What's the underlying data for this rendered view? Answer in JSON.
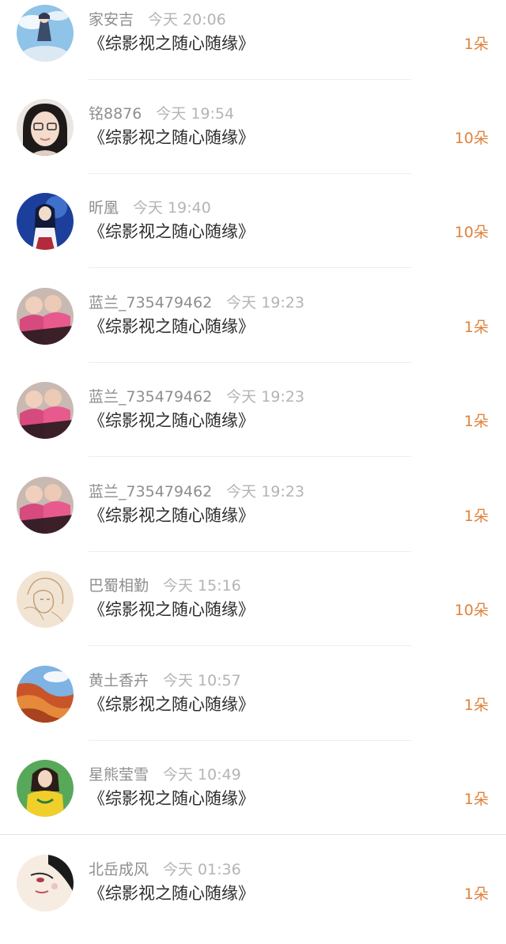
{
  "items": [
    {
      "user": "家安吉",
      "time": "今天 20:06",
      "title": "《综影视之随心随缘》",
      "count": "1朵",
      "avatar": "anime-sky-avatar"
    },
    {
      "user": "铭8876",
      "time": "今天 19:54",
      "title": "《综影视之随心随缘》",
      "count": "10朵",
      "avatar": "girl-glasses-avatar"
    },
    {
      "user": "昕凰",
      "time": "今天 19:40",
      "title": "《综影视之随心随缘》",
      "count": "10朵",
      "avatar": "anime-girl-blue-avatar"
    },
    {
      "user": "蓝兰_735479462",
      "time": "今天 19:23",
      "title": "《综影视之随心随缘》",
      "count": "1朵",
      "avatar": "children-pink-avatar"
    },
    {
      "user": "蓝兰_735479462",
      "time": "今天 19:23",
      "title": "《综影视之随心随缘》",
      "count": "1朵",
      "avatar": "children-pink-avatar"
    },
    {
      "user": "蓝兰_735479462",
      "time": "今天 19:23",
      "title": "《综影视之随心随缘》",
      "count": "1朵",
      "avatar": "children-pink-avatar"
    },
    {
      "user": "巴蜀相勤",
      "time": "今天 15:16",
      "title": "《综影视之随心随缘》",
      "count": "10朵",
      "avatar": "sketch-portrait-avatar"
    },
    {
      "user": "黄土香卉",
      "time": "今天 10:57",
      "title": "《综影视之随心随缘》",
      "count": "1朵",
      "avatar": "canyon-landscape-avatar"
    },
    {
      "user": "星熊莹雪",
      "time": "今天 10:49",
      "title": "《综影视之随心随缘》",
      "count": "1朵",
      "avatar": "woman-yellow-avatar"
    },
    {
      "user": "北岳成风",
      "time": "今天 01:36",
      "title": "《综影视之随心随缘》",
      "count": "1朵",
      "avatar": "painted-face-avatar"
    }
  ]
}
